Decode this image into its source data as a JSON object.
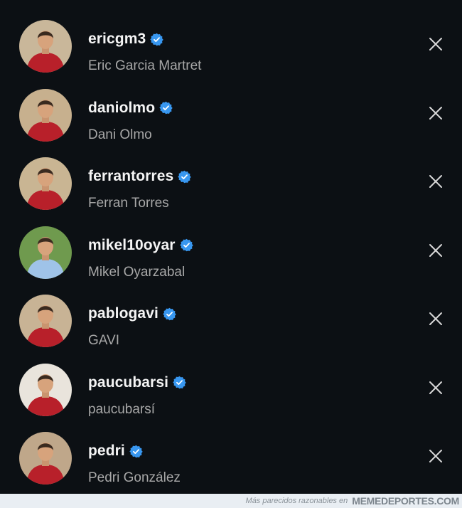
{
  "accounts": [
    {
      "username": "ericgm3",
      "full_name": "Eric Garcia Martret",
      "verified": true,
      "avatar_bg": "#c9b79a",
      "avatar_shirt": "#b8202a"
    },
    {
      "username": "daniolmo",
      "full_name": "Dani Olmo",
      "verified": true,
      "avatar_bg": "#c7b08e",
      "avatar_shirt": "#b8202a"
    },
    {
      "username": "ferrantorres",
      "full_name": "Ferran Torres",
      "verified": true,
      "avatar_bg": "#c9b593",
      "avatar_shirt": "#b8202a"
    },
    {
      "username": "mikel10oyar",
      "full_name": "Mikel Oyarzabal",
      "verified": true,
      "avatar_bg": "#6f9a4e",
      "avatar_shirt": "#9fc3e8"
    },
    {
      "username": "pablogavi",
      "full_name": "GAVI",
      "verified": true,
      "avatar_bg": "#c8b395",
      "avatar_shirt": "#b8202a"
    },
    {
      "username": "paucubarsi",
      "full_name": "paucubarsí",
      "verified": true,
      "avatar_bg": "#e9e4dc",
      "avatar_shirt": "#b8202a"
    },
    {
      "username": "pedri",
      "full_name": "Pedri González",
      "verified": true,
      "avatar_bg": "#bfa78a",
      "avatar_shirt": "#b8202a"
    }
  ],
  "footer": {
    "note": "Más parecidos razonables en",
    "site": "MEMEDEPORTES.COM"
  },
  "colors": {
    "background": "#0c1014",
    "verified_badge": "#3897f0",
    "username_text": "#f5f5f5",
    "fullname_text": "#a8a8a8",
    "dismiss_icon": "#d8d8d8"
  },
  "icons": {
    "verified": "verified-badge-icon",
    "dismiss": "close-icon"
  }
}
